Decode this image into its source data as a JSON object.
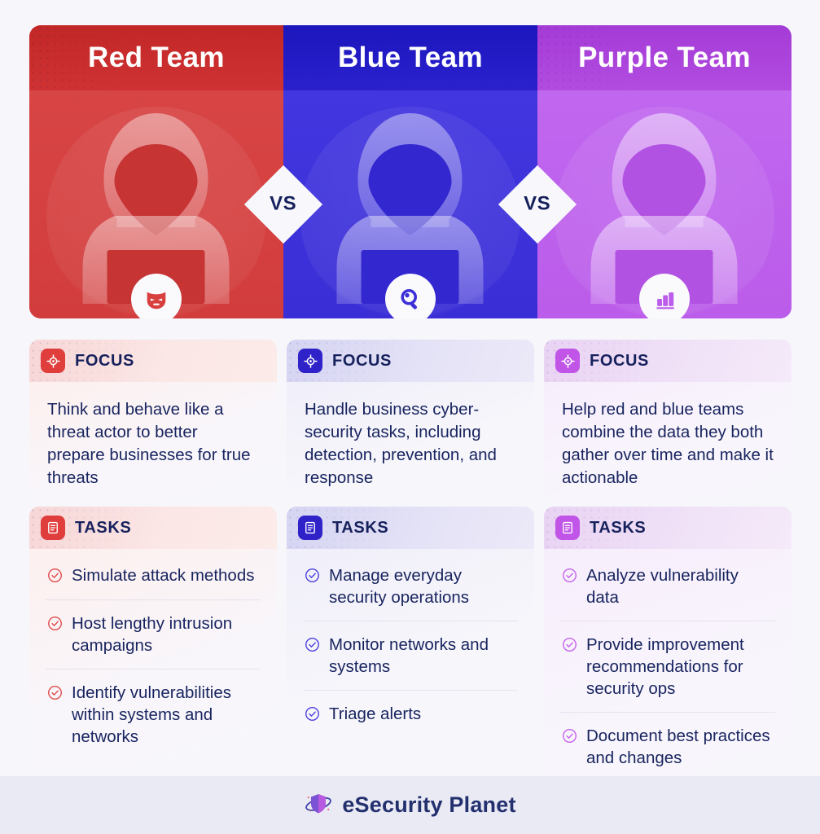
{
  "colors": {
    "background": "#f6f6fb",
    "footer_background": "#eaeaf4",
    "red": "#d83f3f",
    "red_dark": "#c22727",
    "blue": "#3b30d8",
    "blue_dark": "#1c16bd",
    "purple": "#bb5cea",
    "purple_dark": "#a43bd6",
    "navy_text": "#16215c"
  },
  "panels": [
    {
      "title": "Red Team",
      "figure_icon": "hooded-hacker-at-laptop-icon",
      "badge_icon": "hacker-mask-icon"
    },
    {
      "title": "Blue Team",
      "figure_icon": "hooded-hacker-at-laptop-icon",
      "badge_icon": "magnifying-glass-icon"
    },
    {
      "title": "Purple Team",
      "figure_icon": "hooded-hacker-at-laptop-icon",
      "badge_icon": "bar-chart-icon"
    }
  ],
  "vs_badges": [
    "VS",
    "VS"
  ],
  "focus": {
    "heading": "FOCUS",
    "icon": "crosshair-target-icon",
    "cards": [
      {
        "team": "Red Team",
        "text": "Think and behave like a threat actor to better prepare businesses for true threats"
      },
      {
        "team": "Blue Team",
        "text": "Handle business cyber-security tasks, including detection, prevention, and response"
      },
      {
        "team": "Purple Team",
        "text": "Help red and blue teams combine the data they both gather over time and make it actionable"
      }
    ]
  },
  "tasks": {
    "heading": "TASKS",
    "icon": "document-list-icon",
    "cards": [
      {
        "team": "Red Team",
        "items": [
          "Simulate attack methods",
          "Host lengthy intrusion campaigns",
          "Identify vulnerabilities within systems and networks"
        ]
      },
      {
        "team": "Blue Team",
        "items": [
          "Manage everyday security operations",
          "Monitor networks and systems",
          "Triage alerts"
        ]
      },
      {
        "team": "Purple Team",
        "items": [
          "Analyze vulnerability data",
          "Provide improvement recommendations for security ops",
          "Document best practices and changes"
        ]
      }
    ]
  },
  "footer": {
    "logo_icon": "shield-planet-logo-icon",
    "brand": "eSecurity Planet"
  }
}
